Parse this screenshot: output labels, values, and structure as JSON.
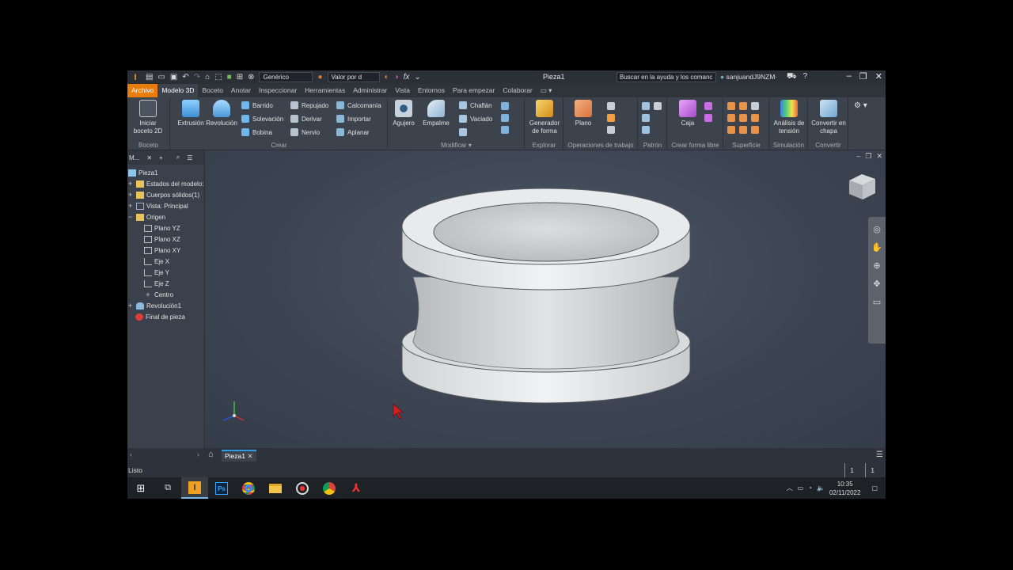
{
  "titlebar": {
    "app_logo": "I",
    "material_combo": "Genérico",
    "appearance_combo": "Valor por d",
    "document_title": "Pieza1",
    "search_placeholder": "Buscar en la ayuda y los comanc",
    "user": "sanjuandJ9NZM·"
  },
  "tabs": [
    "Archivo",
    "Modelo 3D",
    "Boceto",
    "Anotar",
    "Inspeccionar",
    "Herramientas",
    "Administrar",
    "Vista",
    "Entornos",
    "Para empezar",
    "Colaborar"
  ],
  "active_tab": "Modelo 3D",
  "ribbon": {
    "boceto": {
      "label": "Boceto",
      "start_sketch": "Iniciar boceto 2D"
    },
    "crear": {
      "label": "Crear",
      "extrusion": "Extrusión",
      "revolucion": "Revolución",
      "barrido": "Barrido",
      "solevacion": "Solevación",
      "bobina": "Bobina",
      "repujado": "Repujado",
      "derivar": "Derivar",
      "nervio": "Nervio",
      "calcomania": "Calcomanía",
      "importar": "Importar",
      "aplanar": "Aplanar"
    },
    "modificar": {
      "label": "Modificar",
      "agujero": "Agujero",
      "empalme": "Empalme",
      "chaflan": "Chaflán",
      "vaciado": "Vaciado"
    },
    "explorar": {
      "label": "Explorar",
      "generador": "Generador de forma"
    },
    "operaciones": {
      "label": "Operaciones de trabajo",
      "plano": "Plano"
    },
    "patron": {
      "label": "Patrón"
    },
    "forma_libre": {
      "label": "Crear forma libre",
      "caja": "Caja"
    },
    "superficie": {
      "label": "Superficie"
    },
    "simulacion": {
      "label": "Simulación",
      "analisis": "Análisis de tensión"
    },
    "convertir": {
      "label": "Convertir",
      "chapa": "Convertir en chapa"
    }
  },
  "browser": {
    "header": "M...",
    "tree": [
      {
        "label": "Pieza1",
        "expander": ""
      },
      {
        "label": "Estados del modelo: Pr",
        "expander": "+"
      },
      {
        "label": "Cuerpos sólidos(1)",
        "expander": "+"
      },
      {
        "label": "Vista: Principal",
        "expander": "+"
      },
      {
        "label": "Origen",
        "expander": "−"
      },
      {
        "label": "Plano YZ",
        "expander": ""
      },
      {
        "label": "Plano XZ",
        "expander": ""
      },
      {
        "label": "Plano XY",
        "expander": ""
      },
      {
        "label": "Eje X",
        "expander": ""
      },
      {
        "label": "Eje Y",
        "expander": ""
      },
      {
        "label": "Eje Z",
        "expander": ""
      },
      {
        "label": "Centro",
        "expander": ""
      },
      {
        "label": "Revolución1",
        "expander": "+"
      },
      {
        "label": "Final de pieza",
        "expander": ""
      }
    ]
  },
  "document_tab": "Pieza1",
  "status_text": "Listo",
  "status_counters": [
    "1",
    "1"
  ],
  "taskbar": {
    "time": "10:35",
    "date": "02/11/2022",
    "ps_label": "Ps"
  },
  "colors": {
    "accent": "#e87d0d",
    "selection": "#2f9be6",
    "viewport": "#3d4554"
  }
}
